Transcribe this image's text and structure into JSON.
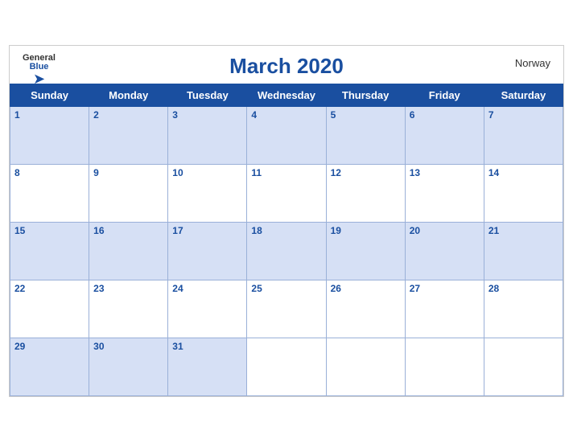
{
  "header": {
    "title": "March 2020",
    "country": "Norway",
    "logo_general": "General",
    "logo_blue": "Blue"
  },
  "weekdays": [
    "Sunday",
    "Monday",
    "Tuesday",
    "Wednesday",
    "Thursday",
    "Friday",
    "Saturday"
  ],
  "weeks": [
    [
      {
        "day": "1",
        "empty": false
      },
      {
        "day": "2",
        "empty": false
      },
      {
        "day": "3",
        "empty": false
      },
      {
        "day": "4",
        "empty": false
      },
      {
        "day": "5",
        "empty": false
      },
      {
        "day": "6",
        "empty": false
      },
      {
        "day": "7",
        "empty": false
      }
    ],
    [
      {
        "day": "8",
        "empty": false
      },
      {
        "day": "9",
        "empty": false
      },
      {
        "day": "10",
        "empty": false
      },
      {
        "day": "11",
        "empty": false
      },
      {
        "day": "12",
        "empty": false
      },
      {
        "day": "13",
        "empty": false
      },
      {
        "day": "14",
        "empty": false
      }
    ],
    [
      {
        "day": "15",
        "empty": false
      },
      {
        "day": "16",
        "empty": false
      },
      {
        "day": "17",
        "empty": false
      },
      {
        "day": "18",
        "empty": false
      },
      {
        "day": "19",
        "empty": false
      },
      {
        "day": "20",
        "empty": false
      },
      {
        "day": "21",
        "empty": false
      }
    ],
    [
      {
        "day": "22",
        "empty": false
      },
      {
        "day": "23",
        "empty": false
      },
      {
        "day": "24",
        "empty": false
      },
      {
        "day": "25",
        "empty": false
      },
      {
        "day": "26",
        "empty": false
      },
      {
        "day": "27",
        "empty": false
      },
      {
        "day": "28",
        "empty": false
      }
    ],
    [
      {
        "day": "29",
        "empty": false
      },
      {
        "day": "30",
        "empty": false
      },
      {
        "day": "31",
        "empty": false
      },
      {
        "day": "",
        "empty": true
      },
      {
        "day": "",
        "empty": true
      },
      {
        "day": "",
        "empty": true
      },
      {
        "day": "",
        "empty": true
      }
    ]
  ]
}
